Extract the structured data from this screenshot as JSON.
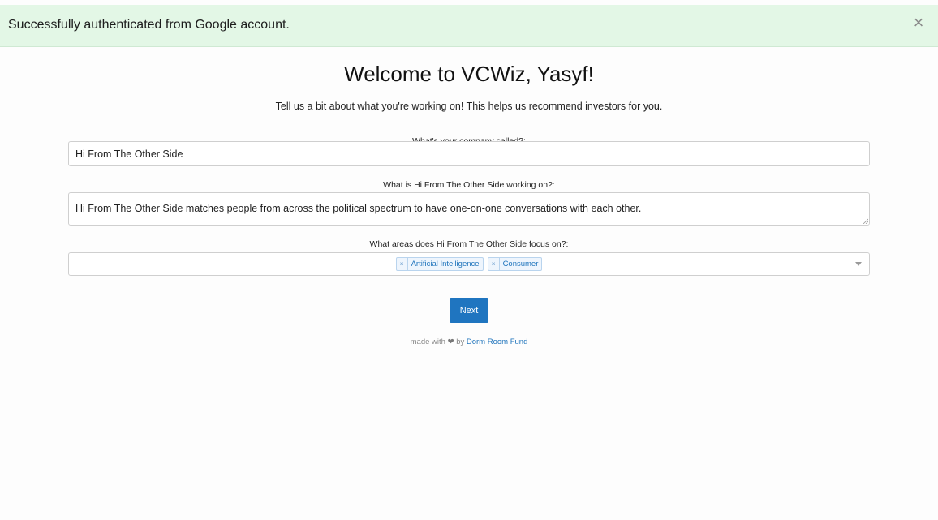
{
  "alert": {
    "message": "Successfully authenticated from Google account.",
    "close_icon": "×"
  },
  "header": {
    "title": "Welcome to VCWiz, Yasyf!",
    "intro": "Tell us a bit about what you're working on! This helps us recommend investors for you."
  },
  "form": {
    "company_label": "What's your company called?:",
    "company_value": "Hi From The Other Side",
    "description_label": "What is Hi From The Other Side working on?:",
    "description_value": "Hi From The Other Side matches people from across the political spectrum to have one-on-one conversations with each other.",
    "areas_label": "What areas does Hi From The Other Side focus on?:",
    "areas": [
      {
        "label": "Artificial Intelligence",
        "remove": "×"
      },
      {
        "label": "Consumer",
        "remove": "×"
      }
    ],
    "next_label": "Next"
  },
  "footer": {
    "prefix": "made with",
    "heart": "❤",
    "by": "by",
    "link": "Dorm Room Fund"
  },
  "colors": {
    "alert_bg": "#e3f7e6",
    "primary": "#1f75c0",
    "tag_text": "#1f74bc"
  }
}
